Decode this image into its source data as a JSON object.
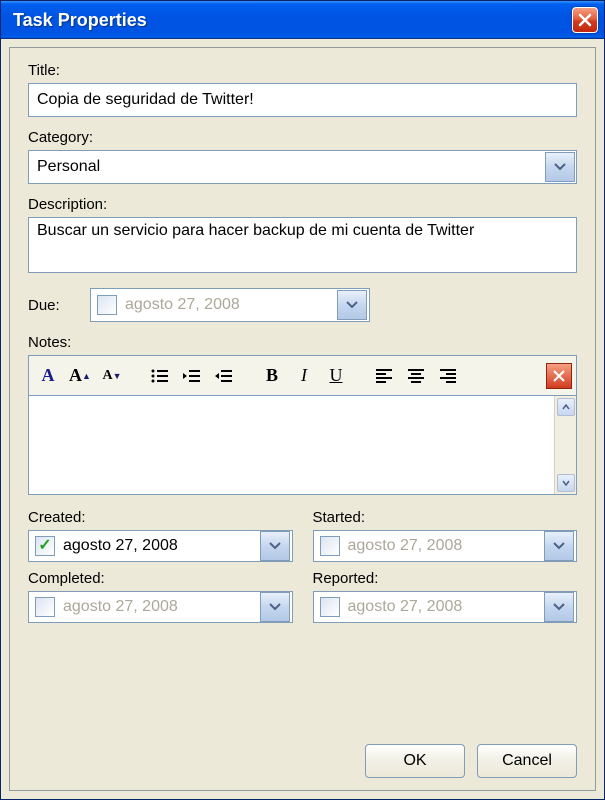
{
  "window": {
    "title": "Task Properties"
  },
  "fields": {
    "title_label": "Title:",
    "title_value": "Copia de seguridad de Twitter!",
    "category_label": "Category:",
    "category_value": "Personal",
    "description_label": "Description:",
    "description_value": "Buscar un servicio para hacer backup de mi cuenta de Twitter",
    "due_label": "Due:",
    "due_value": "agosto   27, 2008",
    "notes_label": "Notes:"
  },
  "dates": {
    "created_label": "Created:",
    "created_value": "agosto   27, 2008",
    "started_label": "Started:",
    "started_value": "agosto   27, 2008",
    "completed_label": "Completed:",
    "completed_value": "agosto   27, 2008",
    "reported_label": "Reported:",
    "reported_value": "agosto   27, 2008"
  },
  "buttons": {
    "ok": "OK",
    "cancel": "Cancel"
  }
}
